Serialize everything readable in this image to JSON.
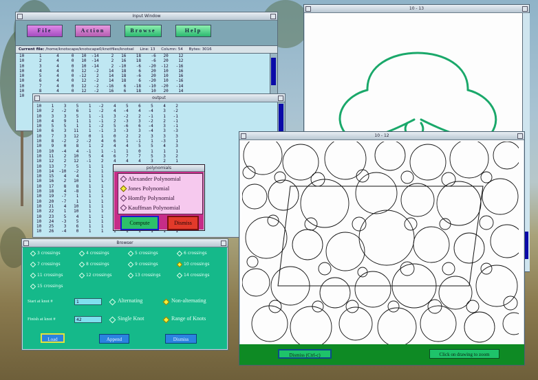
{
  "input_window": {
    "title": "Input Window",
    "menu": {
      "file": "File",
      "action": "Action",
      "browse": "Browse",
      "help": "Help"
    },
    "current_file_label": "Current file:",
    "current_file": "/home/knotscape/knotscape0/knotfiles/knotsel",
    "line_label": "Line:",
    "line": "13",
    "column_label": "Column:",
    "column": "54",
    "bytes_label": "Bytes:",
    "bytes": "3016",
    "lines": [
      "10      1      4     0   10  -14     2   16    18    -6   20    12",
      "10      2      4     0   10  -14     2   16    18    -6   20    12",
      "10      3      4     0   10  -14     2  -10    -6   -20  -12   -16",
      "10      4      4     0   12   -2    14   18     6    20   10    16",
      "10      5      4     0  -12    2    14   18    -6    20   10    16",
      "10      6      4     0   12   -2    14   18     6   -20   10   -16",
      "10      7      4     0   12   -2   -16    6   -18   -10  -20   -14",
      "10      8      4     0   12   -2    16    6    18    10   20    14",
      "10      9      4     0   12    2   -16   -6   -18   -10  -20   -14"
    ]
  },
  "output_window": {
    "title": "output",
    "lines": [
      "10    1    3    5    1   -2    4    5    6    5    4    2",
      "10    2   -2    6    1   -2    4   -4    4   -4    3   -2",
      "10    3    3    5    1   -1    3   -2    2   -1    1   -1",
      "10    4    9    1    1   -1    2   -3    3   -2    2   -1",
      "10    5    5    1    1   -2    5   -6    6   -4    3   -1",
      "10    6    3   11    1   -1    3   -3    3   -4    3   -3",
      "10    7    3   12    0    1    0    2    2    3    3    3",
      "10    8   -2    2   -2    4    6    1   -1    1   -3    1",
      "10    9    0    8    1    2    4    4    5    5    4    3",
      "10   10   -4    4   -1    1   -1    1    0    1    1    1",
      "10   11    2   10    5    4    6    7    7    5    3    2",
      "10   12    2   12   -1    2    4    4    4    3    2    1",
      "10   13    7    5    1    1    1    2    1    1    1    1",
      "10   14  -10   -2    1    1    2    1    1    2    1    1",
      "10   15    4    4    1    1    1    1    1    1    1    1",
      "10   16    2   10    1    1    1    1    1    1    1    1",
      "10   17    8    8    1    1    1    1    1    1    1    1",
      "10   18    4   -8    1    1    1    1    1    1    1    1",
      "10   19   -7    1    1    1    1    1    1    1    1    1",
      "10   20   -7    1    1    1    1    1    1    1    1    1",
      "10   21    4   10    1    1    1    1    1    1    1    1",
      "10   22    1   10    1    1    1    1    1    1    1    1",
      "10   23    5    4    1    1    1    1    1    1    1    1",
      "10   24   -3    5    1    1    1    1    1    1    1    1",
      "10   25    3    6    1    1    1    1    1    1    1    1",
      "10   26   -4    0    1    1    1    1    1    1    1    1"
    ]
  },
  "polynomials_dialog": {
    "title": "polynomials",
    "items": [
      {
        "label": "Alexander Polynomial",
        "checked": false
      },
      {
        "label": "Jones Polynomial",
        "checked": true
      },
      {
        "label": "Homfly Polynomial",
        "checked": false
      },
      {
        "label": "Kauffman Polynomial",
        "checked": false
      }
    ],
    "compute": "Compute",
    "dismiss": "Dismiss"
  },
  "browser_window": {
    "title": "Browser",
    "crossings": [
      {
        "label": "3 crossings",
        "checked": false
      },
      {
        "label": "4 crossings",
        "checked": false
      },
      {
        "label": "5 crossings",
        "checked": false
      },
      {
        "label": "6 crossings",
        "checked": false
      },
      {
        "label": "7 crossings",
        "checked": false
      },
      {
        "label": "8 crossings",
        "checked": false
      },
      {
        "label": "9 crossings",
        "checked": false
      },
      {
        "label": "10 crossings",
        "checked": true
      },
      {
        "label": "11 crossings",
        "checked": false
      },
      {
        "label": "12 crossings",
        "checked": false
      },
      {
        "label": "13 crossings",
        "checked": false
      },
      {
        "label": "14 crossings",
        "checked": false
      },
      {
        "label": "15 crossings",
        "checked": false
      }
    ],
    "start_label": "Start at knot #",
    "start_value": "1",
    "finish_label": "Finish at knot #",
    "finish_value": "42",
    "alternating": "Alternating",
    "non_alternating": "Non-alternating",
    "single_knot": "Single Knot",
    "range_of_knots": "Range of Knots",
    "load": "Load",
    "append": "Append",
    "dismiss": "Dismiss"
  },
  "knot_window_a": {
    "title": "10 - 13"
  },
  "knot_window_b": {
    "title": "10 - 12",
    "dismiss": "Dismiss   (Ctrl-c)",
    "zoom_hint": "Click on drawing to zoom"
  },
  "colors": {
    "knot_curve": "#1aa86a",
    "browser_bg": "#15b98a",
    "dialog_bg": "#c62d88",
    "scroll_thumb": "#0a0aa8"
  }
}
